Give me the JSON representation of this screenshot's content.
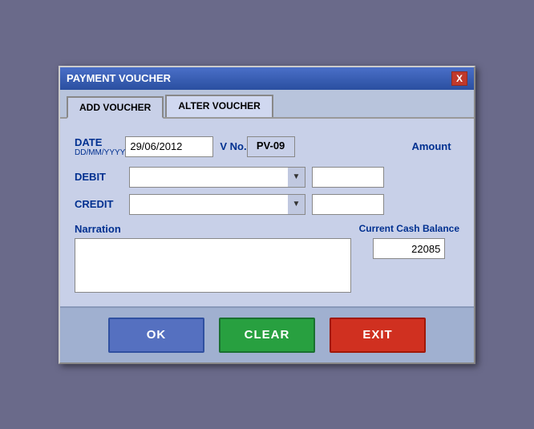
{
  "window": {
    "title": "PAYMENT VOUCHER",
    "close_label": "X"
  },
  "tabs": [
    {
      "label": "ADD VOUCHER",
      "active": true
    },
    {
      "label": "ALTER VOUCHER",
      "active": false
    }
  ],
  "form": {
    "date_label": "DATE",
    "date_format": "DD/MM/YYYY",
    "date_value": "29/06/2012",
    "vno_label": "V No.",
    "vno_value": "PV-09",
    "amount_label": "Amount",
    "debit_label": "DEBIT",
    "debit_value": "",
    "debit_amount": "",
    "credit_label": "CREDIT",
    "credit_value": "",
    "credit_amount": "",
    "narration_label": "Narration",
    "narration_value": "",
    "cash_balance_label": "Current Cash Balance",
    "cash_balance_value": "22085"
  },
  "buttons": {
    "ok_label": "OK",
    "clear_label": "CLEAR",
    "exit_label": "EXIT"
  },
  "icons": {
    "dropdown_arrow": "▼"
  }
}
